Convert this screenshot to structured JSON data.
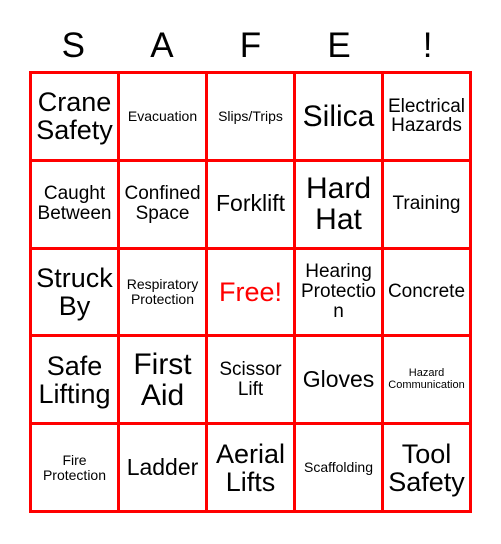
{
  "card": {
    "title": "SAFE! Bingo Card",
    "grid_border_color": "#ff0000",
    "text_color": "#000000",
    "free_text_color": "#ff0000",
    "background_color": "#ffffff",
    "columns": 5,
    "rows": 5
  },
  "header": {
    "letters": [
      "S",
      "A",
      "F",
      "E",
      "!"
    ]
  },
  "cells": [
    {
      "label": "Crane\nSafety",
      "size": "xl",
      "free": false
    },
    {
      "label": "Evacuation",
      "size": "sm",
      "free": false
    },
    {
      "label": "Slips/Trips",
      "size": "sm",
      "free": false
    },
    {
      "label": "Silica",
      "size": "xxl",
      "free": false
    },
    {
      "label": "Electrical\nHazards",
      "size": "md",
      "free": false
    },
    {
      "label": "Caught\nBetween",
      "size": "md",
      "free": false
    },
    {
      "label": "Confined\nSpace",
      "size": "md",
      "free": false
    },
    {
      "label": "Forklift",
      "size": "lg",
      "free": false
    },
    {
      "label": "Hard\nHat",
      "size": "xxl",
      "free": false
    },
    {
      "label": "Training",
      "size": "md",
      "free": false
    },
    {
      "label": "Struck\nBy",
      "size": "xl",
      "free": false
    },
    {
      "label": "Respiratory\nProtection",
      "size": "sm",
      "free": false
    },
    {
      "label": "Free!",
      "size": "xl",
      "free": true
    },
    {
      "label": "Hearing\nProtection",
      "size": "md",
      "free": false
    },
    {
      "label": "Concrete",
      "size": "md",
      "free": false
    },
    {
      "label": "Safe\nLifting",
      "size": "xl",
      "free": false
    },
    {
      "label": "First\nAid",
      "size": "xxl",
      "free": false
    },
    {
      "label": "Scissor\nLift",
      "size": "md",
      "free": false
    },
    {
      "label": "Gloves",
      "size": "lg",
      "free": false
    },
    {
      "label": "Hazard\nCommunication",
      "size": "xs",
      "free": false
    },
    {
      "label": "Fire\nProtection",
      "size": "sm",
      "free": false
    },
    {
      "label": "Ladder",
      "size": "lg",
      "free": false
    },
    {
      "label": "Aerial\nLifts",
      "size": "xl",
      "free": false
    },
    {
      "label": "Scaffolding",
      "size": "sm",
      "free": false
    },
    {
      "label": "Tool\nSafety",
      "size": "xl",
      "free": false
    }
  ]
}
